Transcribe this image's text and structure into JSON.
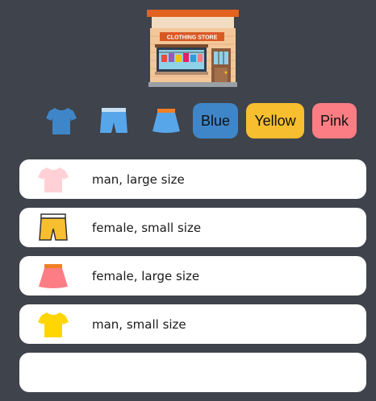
{
  "store": {
    "sign_text": "CLOTHING STORE"
  },
  "toolbar": {
    "filters": [
      {
        "icon": "tshirt-icon"
      },
      {
        "icon": "pants-icon"
      },
      {
        "icon": "skirt-icon"
      }
    ],
    "colors": [
      {
        "label": "Blue",
        "color": "#3f86c8"
      },
      {
        "label": "Yellow",
        "color": "#f7be2f"
      },
      {
        "label": "Pink",
        "color": "#fd7d84"
      }
    ]
  },
  "items": [
    {
      "label": "man, large size",
      "icon": "tshirt-icon",
      "color": "#ffd1d6"
    },
    {
      "label": "female, small size",
      "icon": "pants-icon",
      "color": "#f7be2f"
    },
    {
      "label": "female, large size",
      "icon": "skirt-icon",
      "color": "#fd7d84"
    },
    {
      "label": "man, small size",
      "icon": "tshirt-icon",
      "color": "#ffd600"
    }
  ]
}
